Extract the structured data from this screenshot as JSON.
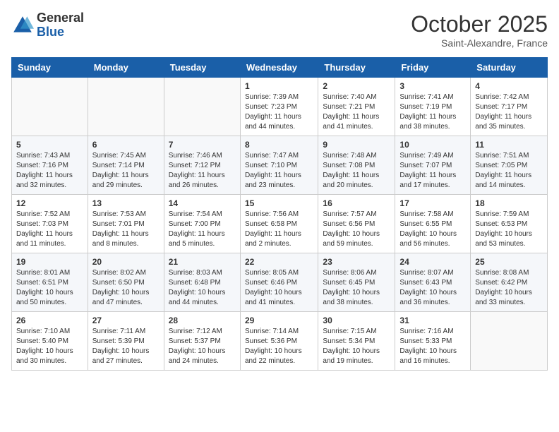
{
  "logo": {
    "general": "General",
    "blue": "Blue"
  },
  "title": "October 2025",
  "location": "Saint-Alexandre, France",
  "days_of_week": [
    "Sunday",
    "Monday",
    "Tuesday",
    "Wednesday",
    "Thursday",
    "Friday",
    "Saturday"
  ],
  "weeks": [
    [
      {
        "day": "",
        "sunrise": "",
        "sunset": "",
        "daylight": ""
      },
      {
        "day": "",
        "sunrise": "",
        "sunset": "",
        "daylight": ""
      },
      {
        "day": "",
        "sunrise": "",
        "sunset": "",
        "daylight": ""
      },
      {
        "day": "1",
        "sunrise": "Sunrise: 7:39 AM",
        "sunset": "Sunset: 7:23 PM",
        "daylight": "Daylight: 11 hours and 44 minutes."
      },
      {
        "day": "2",
        "sunrise": "Sunrise: 7:40 AM",
        "sunset": "Sunset: 7:21 PM",
        "daylight": "Daylight: 11 hours and 41 minutes."
      },
      {
        "day": "3",
        "sunrise": "Sunrise: 7:41 AM",
        "sunset": "Sunset: 7:19 PM",
        "daylight": "Daylight: 11 hours and 38 minutes."
      },
      {
        "day": "4",
        "sunrise": "Sunrise: 7:42 AM",
        "sunset": "Sunset: 7:17 PM",
        "daylight": "Daylight: 11 hours and 35 minutes."
      }
    ],
    [
      {
        "day": "5",
        "sunrise": "Sunrise: 7:43 AM",
        "sunset": "Sunset: 7:16 PM",
        "daylight": "Daylight: 11 hours and 32 minutes."
      },
      {
        "day": "6",
        "sunrise": "Sunrise: 7:45 AM",
        "sunset": "Sunset: 7:14 PM",
        "daylight": "Daylight: 11 hours and 29 minutes."
      },
      {
        "day": "7",
        "sunrise": "Sunrise: 7:46 AM",
        "sunset": "Sunset: 7:12 PM",
        "daylight": "Daylight: 11 hours and 26 minutes."
      },
      {
        "day": "8",
        "sunrise": "Sunrise: 7:47 AM",
        "sunset": "Sunset: 7:10 PM",
        "daylight": "Daylight: 11 hours and 23 minutes."
      },
      {
        "day": "9",
        "sunrise": "Sunrise: 7:48 AM",
        "sunset": "Sunset: 7:08 PM",
        "daylight": "Daylight: 11 hours and 20 minutes."
      },
      {
        "day": "10",
        "sunrise": "Sunrise: 7:49 AM",
        "sunset": "Sunset: 7:07 PM",
        "daylight": "Daylight: 11 hours and 17 minutes."
      },
      {
        "day": "11",
        "sunrise": "Sunrise: 7:51 AM",
        "sunset": "Sunset: 7:05 PM",
        "daylight": "Daylight: 11 hours and 14 minutes."
      }
    ],
    [
      {
        "day": "12",
        "sunrise": "Sunrise: 7:52 AM",
        "sunset": "Sunset: 7:03 PM",
        "daylight": "Daylight: 11 hours and 11 minutes."
      },
      {
        "day": "13",
        "sunrise": "Sunrise: 7:53 AM",
        "sunset": "Sunset: 7:01 PM",
        "daylight": "Daylight: 11 hours and 8 minutes."
      },
      {
        "day": "14",
        "sunrise": "Sunrise: 7:54 AM",
        "sunset": "Sunset: 7:00 PM",
        "daylight": "Daylight: 11 hours and 5 minutes."
      },
      {
        "day": "15",
        "sunrise": "Sunrise: 7:56 AM",
        "sunset": "Sunset: 6:58 PM",
        "daylight": "Daylight: 11 hours and 2 minutes."
      },
      {
        "day": "16",
        "sunrise": "Sunrise: 7:57 AM",
        "sunset": "Sunset: 6:56 PM",
        "daylight": "Daylight: 10 hours and 59 minutes."
      },
      {
        "day": "17",
        "sunrise": "Sunrise: 7:58 AM",
        "sunset": "Sunset: 6:55 PM",
        "daylight": "Daylight: 10 hours and 56 minutes."
      },
      {
        "day": "18",
        "sunrise": "Sunrise: 7:59 AM",
        "sunset": "Sunset: 6:53 PM",
        "daylight": "Daylight: 10 hours and 53 minutes."
      }
    ],
    [
      {
        "day": "19",
        "sunrise": "Sunrise: 8:01 AM",
        "sunset": "Sunset: 6:51 PM",
        "daylight": "Daylight: 10 hours and 50 minutes."
      },
      {
        "day": "20",
        "sunrise": "Sunrise: 8:02 AM",
        "sunset": "Sunset: 6:50 PM",
        "daylight": "Daylight: 10 hours and 47 minutes."
      },
      {
        "day": "21",
        "sunrise": "Sunrise: 8:03 AM",
        "sunset": "Sunset: 6:48 PM",
        "daylight": "Daylight: 10 hours and 44 minutes."
      },
      {
        "day": "22",
        "sunrise": "Sunrise: 8:05 AM",
        "sunset": "Sunset: 6:46 PM",
        "daylight": "Daylight: 10 hours and 41 minutes."
      },
      {
        "day": "23",
        "sunrise": "Sunrise: 8:06 AM",
        "sunset": "Sunset: 6:45 PM",
        "daylight": "Daylight: 10 hours and 38 minutes."
      },
      {
        "day": "24",
        "sunrise": "Sunrise: 8:07 AM",
        "sunset": "Sunset: 6:43 PM",
        "daylight": "Daylight: 10 hours and 36 minutes."
      },
      {
        "day": "25",
        "sunrise": "Sunrise: 8:08 AM",
        "sunset": "Sunset: 6:42 PM",
        "daylight": "Daylight: 10 hours and 33 minutes."
      }
    ],
    [
      {
        "day": "26",
        "sunrise": "Sunrise: 7:10 AM",
        "sunset": "Sunset: 5:40 PM",
        "daylight": "Daylight: 10 hours and 30 minutes."
      },
      {
        "day": "27",
        "sunrise": "Sunrise: 7:11 AM",
        "sunset": "Sunset: 5:39 PM",
        "daylight": "Daylight: 10 hours and 27 minutes."
      },
      {
        "day": "28",
        "sunrise": "Sunrise: 7:12 AM",
        "sunset": "Sunset: 5:37 PM",
        "daylight": "Daylight: 10 hours and 24 minutes."
      },
      {
        "day": "29",
        "sunrise": "Sunrise: 7:14 AM",
        "sunset": "Sunset: 5:36 PM",
        "daylight": "Daylight: 10 hours and 22 minutes."
      },
      {
        "day": "30",
        "sunrise": "Sunrise: 7:15 AM",
        "sunset": "Sunset: 5:34 PM",
        "daylight": "Daylight: 10 hours and 19 minutes."
      },
      {
        "day": "31",
        "sunrise": "Sunrise: 7:16 AM",
        "sunset": "Sunset: 5:33 PM",
        "daylight": "Daylight: 10 hours and 16 minutes."
      },
      {
        "day": "",
        "sunrise": "",
        "sunset": "",
        "daylight": ""
      }
    ]
  ]
}
